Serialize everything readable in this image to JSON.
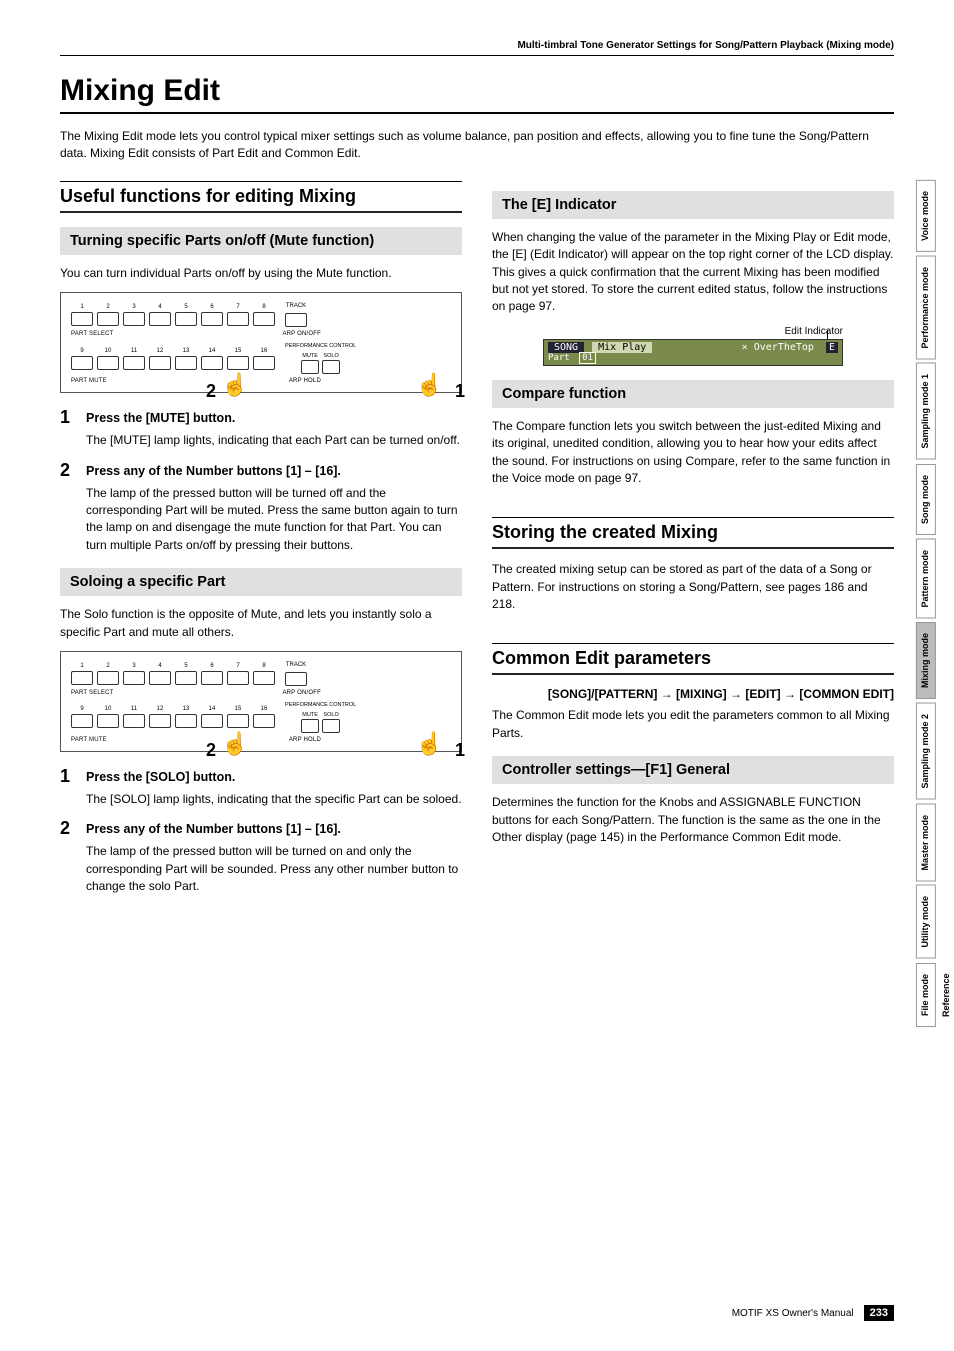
{
  "running_head": "Multi-timbral Tone Generator Settings for Song/Pattern Playback (Mixing mode)",
  "h1": "Mixing Edit",
  "intro": "The Mixing Edit mode lets you control typical mixer settings such as volume balance, pan position and effects, allowing you to fine tune the Song/Pattern data. Mixing Edit consists of Part Edit and Common Edit.",
  "left": {
    "h2": "Useful functions for editing Mixing",
    "mute": {
      "h3": "Turning specific Parts on/off (Mute function)",
      "intro": "You can turn individual Parts on/off by using the Mute function.",
      "panel": {
        "nums_top": [
          "1",
          "2",
          "3",
          "4",
          "5",
          "6",
          "7",
          "8"
        ],
        "nums_bot": [
          "9",
          "10",
          "11",
          "12",
          "13",
          "14",
          "15",
          "16"
        ],
        "label_top": "PART SELECT",
        "label_top_r": "ARP ON/OFF",
        "label_bot": "PART MUTE",
        "label_bot_r": "ARP HOLD",
        "right_track": "TRACK",
        "right_perf": "PERFORMANCE CONTROL",
        "right_mute": "MUTE",
        "right_solo": "SOLO",
        "callout1": "1",
        "callout2": "2"
      },
      "steps": [
        {
          "num": "1",
          "title": "Press the [MUTE] button.",
          "body": "The [MUTE] lamp lights, indicating that each Part can be turned on/off."
        },
        {
          "num": "2",
          "title": "Press any of the Number buttons [1] – [16].",
          "body": "The lamp of the pressed button will be turned off and the corresponding Part will be muted.\nPress the same button again to turn the lamp on and disengage the mute function for that Part. You can turn multiple Parts on/off by pressing their buttons."
        }
      ]
    },
    "solo": {
      "h3": "Soloing a specific Part",
      "intro": "The Solo function is the opposite of Mute, and lets you instantly solo a specific Part and mute all others.",
      "panel": {
        "right_solo": "SOLO",
        "callout1": "1",
        "callout2": "2"
      },
      "steps": [
        {
          "num": "1",
          "title": "Press the [SOLO] button.",
          "body": "The [SOLO] lamp lights, indicating that the specific Part can be soloed."
        },
        {
          "num": "2",
          "title": "Press any of the Number buttons [1] – [16].",
          "body": "The lamp of the pressed button will be turned on and only the corresponding Part will be sounded.\nPress any other number button to change the solo Part."
        }
      ]
    }
  },
  "right": {
    "eind": {
      "h3": "The [E] Indicator",
      "body": "When changing the value of the parameter in the Mixing Play or Edit mode, the [E] (Edit Indicator) will appear on the top right corner of the LCD display. This gives a quick confirmation that the current Mixing has been modified but not yet stored. To store the current edited status, follow the instructions on page 97.",
      "caption": "Edit Indicator",
      "lcd": {
        "song": "SONG",
        "mix": "Mix Play",
        "over": "× OverTheTop",
        "e": "E",
        "part": "Part",
        "num": "01"
      }
    },
    "compare": {
      "h3": "Compare function",
      "body": "The Compare function lets you switch between the just-edited Mixing and its original, unedited condition, allowing you to hear how your edits affect the sound. For instructions on using Compare, refer to the same function in the Voice mode on page 97."
    },
    "storing": {
      "h2": "Storing the created Mixing",
      "body": "The created mixing setup can be stored as part of the data of a Song or Pattern. For instructions on storing a Song/Pattern, see pages 186 and 218."
    },
    "common": {
      "h2": "Common Edit parameters",
      "breadcrumb": "[SONG]/[PATTERN] → [MIXING] → [EDIT] → [COMMON EDIT]",
      "body": "The Common Edit mode lets you edit the parameters common to all Mixing Parts.",
      "controller": {
        "h3": "Controller settings—[F1] General",
        "body": "Determines the function for the Knobs and ASSIGNABLE FUNCTION buttons for each Song/Pattern.\nThe function is the same as the one in the Other display (page 145) in the Performance Common Edit mode."
      }
    }
  },
  "tabs": [
    "Voice mode",
    "Performance mode",
    "Sampling mode 1",
    "Song mode",
    "Pattern mode",
    "Mixing mode",
    "Sampling mode 2",
    "Master mode",
    "Utility mode",
    "File mode"
  ],
  "tab_active_index": 5,
  "tab_ref": "Reference",
  "footer": {
    "manual": "MOTIF XS Owner's Manual",
    "page": "233"
  }
}
